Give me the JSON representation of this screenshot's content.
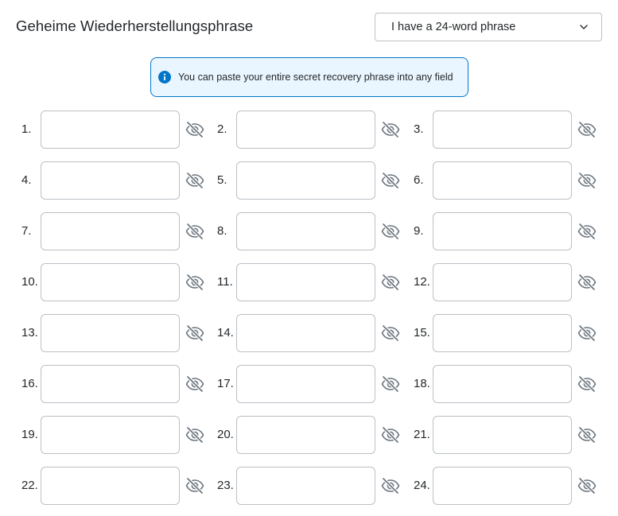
{
  "header": {
    "title": "Geheime Wiederherstellungsphrase"
  },
  "phrase_select": {
    "selected": "I have a 24-word phrase",
    "icon": "chevron-down-icon"
  },
  "info_banner": {
    "text": "You can paste your entire secret recovery phrase into any field",
    "icon": "info-icon",
    "accent_color": "#0376c9",
    "background_color": "#eaf6ff"
  },
  "words": [
    {
      "label": "1.",
      "value": ""
    },
    {
      "label": "2.",
      "value": ""
    },
    {
      "label": "3.",
      "value": ""
    },
    {
      "label": "4.",
      "value": ""
    },
    {
      "label": "5.",
      "value": ""
    },
    {
      "label": "6.",
      "value": ""
    },
    {
      "label": "7.",
      "value": ""
    },
    {
      "label": "8.",
      "value": ""
    },
    {
      "label": "9.",
      "value": ""
    },
    {
      "label": "10.",
      "value": ""
    },
    {
      "label": "11.",
      "value": ""
    },
    {
      "label": "12.",
      "value": ""
    },
    {
      "label": "13.",
      "value": ""
    },
    {
      "label": "14.",
      "value": ""
    },
    {
      "label": "15.",
      "value": ""
    },
    {
      "label": "16.",
      "value": ""
    },
    {
      "label": "17.",
      "value": ""
    },
    {
      "label": "18.",
      "value": ""
    },
    {
      "label": "19.",
      "value": ""
    },
    {
      "label": "20.",
      "value": ""
    },
    {
      "label": "21.",
      "value": ""
    },
    {
      "label": "22.",
      "value": ""
    },
    {
      "label": "23.",
      "value": ""
    },
    {
      "label": "24.",
      "value": ""
    }
  ],
  "toggle_icon": "eye-slash-icon"
}
